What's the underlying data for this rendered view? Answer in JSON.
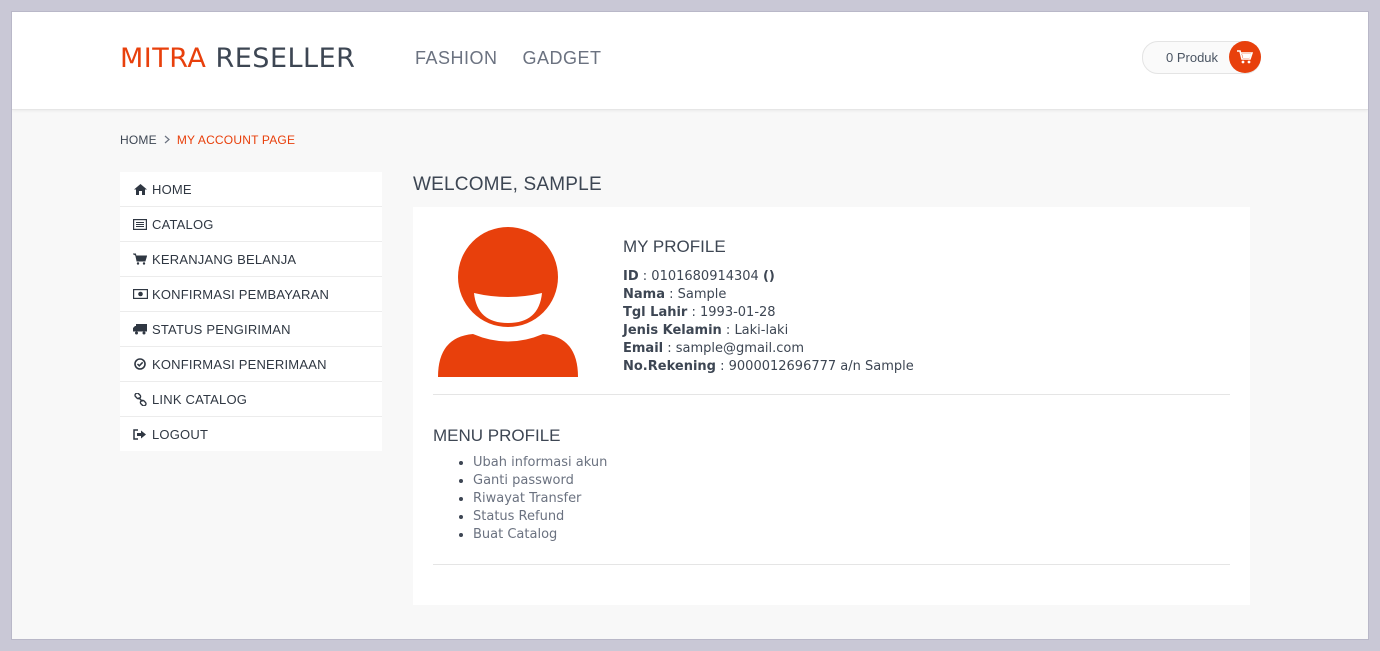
{
  "colors": {
    "accent": "#e8400c",
    "text": "#3d4653"
  },
  "header": {
    "logo_part1": "MITRA",
    "logo_part2": "RESELLER",
    "nav": [
      "FASHION",
      "GADGET"
    ],
    "cart_label": "0 Produk",
    "cart_icon": "cart-icon"
  },
  "breadcrumb": {
    "home": "HOME",
    "current": "MY ACCOUNT PAGE"
  },
  "sidebar": {
    "items": [
      {
        "label": "HOME",
        "icon": "home-icon"
      },
      {
        "label": "CATALOG",
        "icon": "list-icon"
      },
      {
        "label": "KERANJANG BELANJA",
        "icon": "cart-icon"
      },
      {
        "label": "KONFIRMASI PEMBAYARAN",
        "icon": "money-icon"
      },
      {
        "label": "STATUS PENGIRIMAN",
        "icon": "truck-icon"
      },
      {
        "label": "KONFIRMASI PENERIMAAN",
        "icon": "check-circle-icon"
      },
      {
        "label": "LINK CATALOG",
        "icon": "link-icon"
      },
      {
        "label": "LOGOUT",
        "icon": "sign-out-icon"
      }
    ]
  },
  "main": {
    "welcome": "WELCOME, SAMPLE",
    "profile_title": "MY PROFILE",
    "profile": {
      "id_label": "ID",
      "id_value": "0101680914304",
      "id_suffix": "()",
      "nama_label": "Nama",
      "nama_value": "Sample",
      "tgl_label": "Tgl Lahir",
      "tgl_value": "1993-01-28",
      "jk_label": "Jenis Kelamin",
      "jk_value": "Laki-laki",
      "email_label": "Email",
      "email_value": "sample@gmail.com",
      "rek_label": "No.Rekening",
      "rek_value": "9000012696777 a/n Sample"
    },
    "menu_title": "MENU PROFILE",
    "menu_items": [
      "Ubah informasi akun",
      "Ganti password",
      "Riwayat Transfer",
      "Status Refund",
      "Buat Catalog"
    ]
  }
}
